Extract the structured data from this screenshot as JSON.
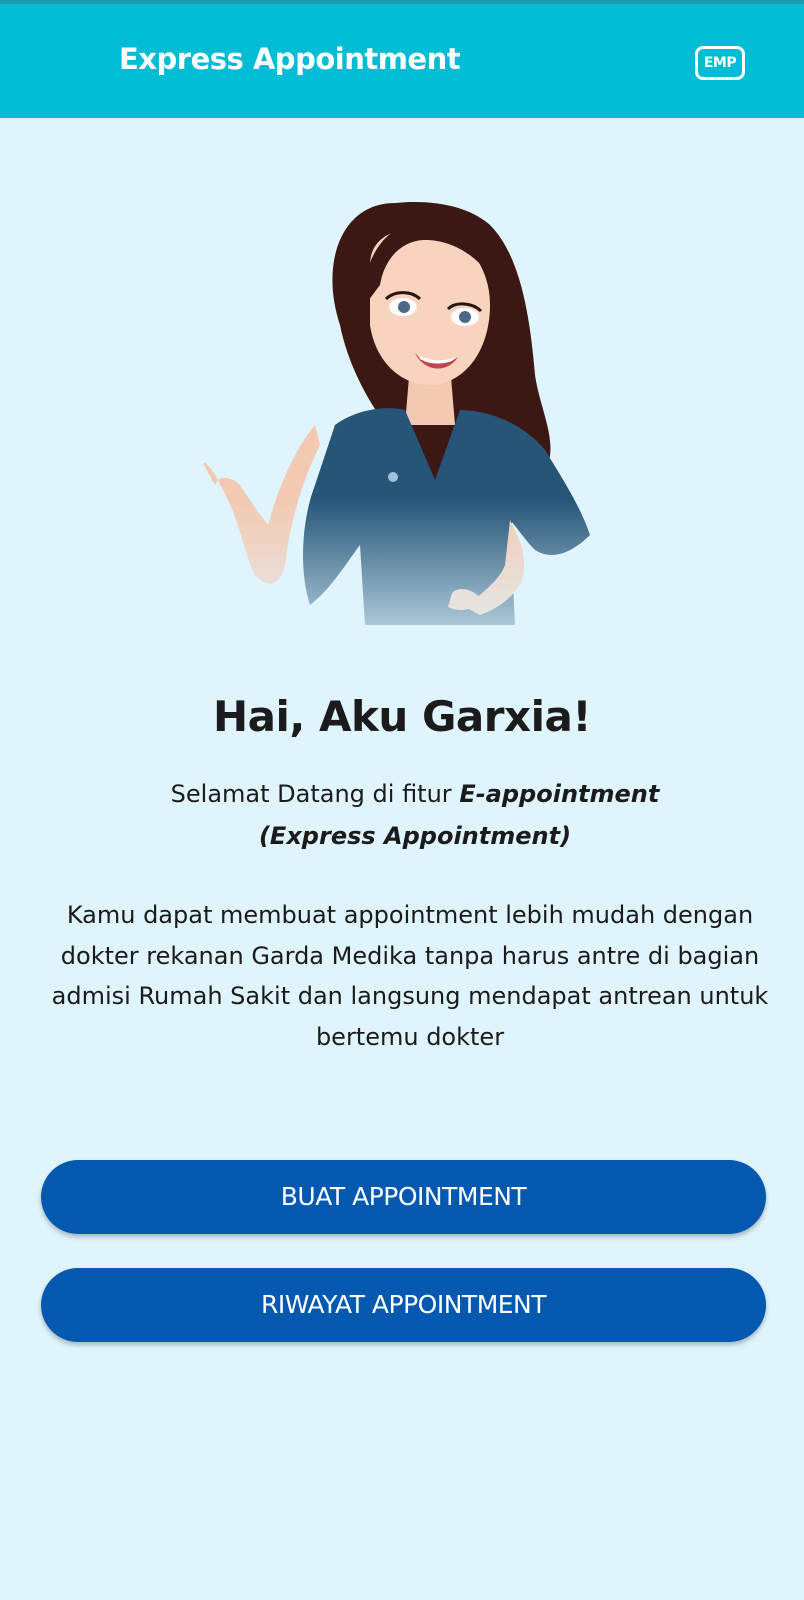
{
  "appbar": {
    "title": "Express Appointment",
    "badge": "EMP"
  },
  "mascot": {
    "icon": "mascot-illustration",
    "shirt_logo": "garda-medika-logo"
  },
  "content": {
    "heading": "Hai, Aku Garxia!",
    "welcome_prefix": "Selamat Datang di fitur ",
    "welcome_feature": "E-appointment (Express Appointment)",
    "description": "Kamu dapat membuat appointment lebih mudah dengan dokter rekanan Garda Medika tanpa harus antre di bagian admisi Rumah Sakit dan langsung mendapat antrean untuk bertemu dokter"
  },
  "actions": {
    "buat_label": "BUAT APPOINTMENT",
    "riwayat_label": "RIWAYAT APPOINTMENT"
  },
  "colors": {
    "appbar": "#00bcd4",
    "background": "#dff4fc",
    "button": "#0359b0",
    "text": "#1b1b1b"
  }
}
